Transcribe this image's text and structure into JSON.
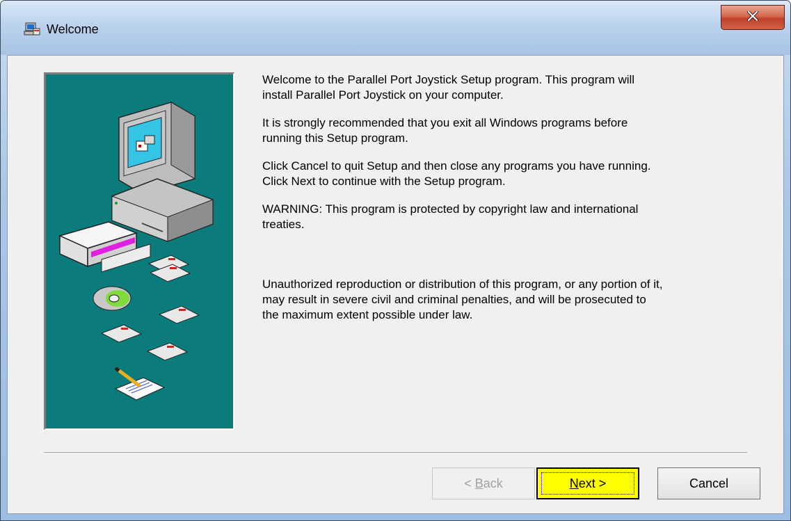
{
  "window": {
    "title": "Welcome",
    "icon": "setup-computer-icon",
    "close_icon": "close-icon",
    "close_color": "#c8432b"
  },
  "content": {
    "paragraphs": [
      "Welcome to the Parallel Port Joystick Setup program. This program will\ninstall Parallel Port Joystick on your computer.",
      "It is strongly recommended that you exit all Windows programs before\nrunning this Setup program.",
      "Click Cancel to quit Setup and then close any programs you have running.\nClick Next to continue with the Setup program.",
      "WARNING: This program is protected by copyright law and international\ntreaties.",
      "Unauthorized reproduction or distribution of this program, or any portion of it,\nmay result in severe civil and criminal penalties, and will be prosecuted to\nthe maximum extent possible under law."
    ]
  },
  "art": {
    "background_color": "#0b7b7b",
    "icon": "setup-illustration-icon"
  },
  "buttons": {
    "back_prefix": "< ",
    "back_mnemonic": "B",
    "back_rest": "ack",
    "next_mnemonic": "N",
    "next_rest": "ext >",
    "cancel_label": "Cancel",
    "next_highlight": "#ffff00"
  }
}
